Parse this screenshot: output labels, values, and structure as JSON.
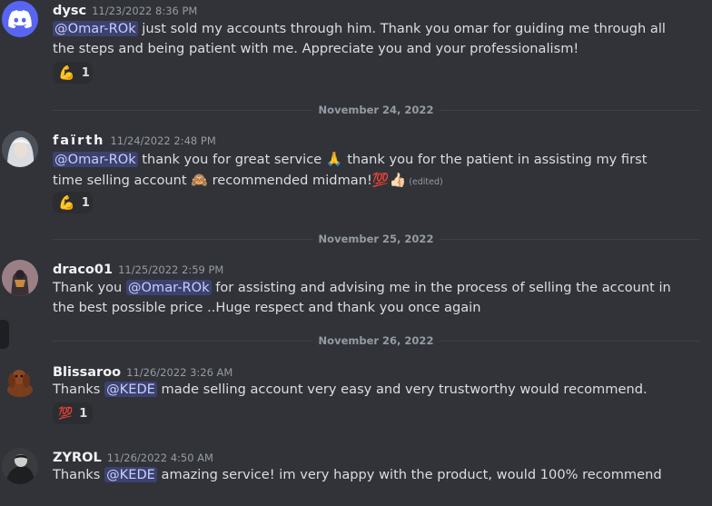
{
  "messages": [
    {
      "author": "dysc",
      "timestamp": "11/23/2022 8:36 PM",
      "mention": "@Omar-ROk",
      "text": "just sold my accounts through him. Thank you omar for guiding me through all the steps and being patient with me. Appreciate you and your professionalism!",
      "reaction": {
        "emoji": "💪",
        "count": "1"
      }
    },
    {
      "author": "faïrth",
      "timestamp": "11/24/2022 2:48 PM",
      "mention": "@Omar-ROk",
      "text_part1": "thank you for great service",
      "emoji1": "🙏",
      "text_part2": "thank you for the patient in assisting my first time selling account",
      "emoji2": "🙈",
      "text_part3": "recommended midman!",
      "emoji3": "💯👍🏻",
      "edited": "(edited)",
      "reaction": {
        "emoji": "💪",
        "count": "1"
      }
    },
    {
      "author": "draco01",
      "timestamp": "11/25/2022 2:59 PM",
      "prefix": "Thank you",
      "mention": "@Omar-ROk",
      "text": "for assisting and advising me in the process of selling the account in the best possible price ..Huge respect and thank you once again"
    },
    {
      "author": "Blissaroo",
      "timestamp": "11/26/2022 3:26 AM",
      "prefix": "Thanks",
      "mention": "@KEDE",
      "text": "made selling account very easy and very trustworthy would recommend.",
      "reaction": {
        "emoji": "💯",
        "count": "1"
      }
    },
    {
      "author": "ZYROL",
      "timestamp": "11/26/2022 4:50 AM",
      "prefix": "Thanks",
      "mention": "@KEDE",
      "text": "amazing service! im very happy with the product, would 100% recommend"
    }
  ],
  "dividers": [
    "November 24, 2022",
    "November 25, 2022",
    "November 26, 2022"
  ],
  "colors": {
    "background": "#313338",
    "mention_bg": "#3c4270",
    "discord_blurple": "#5865f2"
  }
}
